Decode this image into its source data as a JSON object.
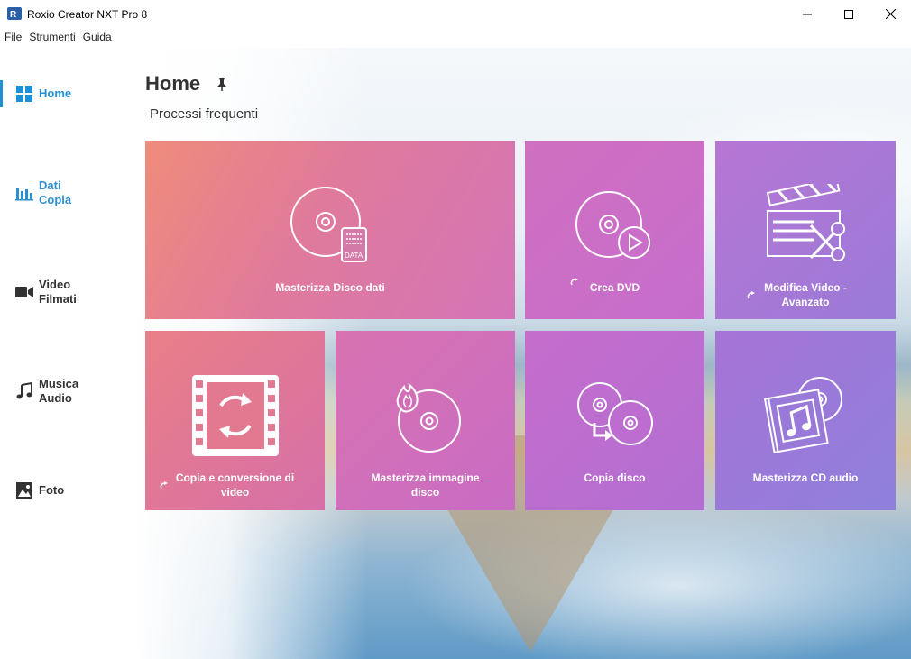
{
  "window": {
    "title": "Roxio Creator NXT Pro 8",
    "app_icon": "roxio-app-icon",
    "controls": [
      "minimize-icon",
      "maximize-icon",
      "close-icon"
    ]
  },
  "menu": [
    {
      "label": "File"
    },
    {
      "label": "Strumenti"
    },
    {
      "label": "Guida"
    }
  ],
  "sidebar": {
    "items": [
      {
        "label": "Home",
        "icon": "grid-icon",
        "active": true
      },
      {
        "label": "Dati\nCopia",
        "icon": "bar-chart-icon"
      },
      {
        "label": "Video\nFilmati",
        "icon": "video-camera-icon"
      },
      {
        "label": "Musica\nAudio",
        "icon": "music-note-icon"
      },
      {
        "label": "Foto",
        "icon": "photo-icon"
      }
    ]
  },
  "main": {
    "title": "Home",
    "pin_icon": "pin-icon",
    "section_title": "Processi frequenti",
    "tiles": [
      {
        "label": "Masterizza Disco dati",
        "icon": "data-disc-icon",
        "arrow": false,
        "color_start": "#ef8c7a",
        "color_end": "#d474b8"
      },
      {
        "label": "Crea  DVD",
        "icon": "dvd-play-icon",
        "arrow": true,
        "color_start": "#cf70c0",
        "color_end": "#c66dcd"
      },
      {
        "label": "Modifica Video -\nAvanzato",
        "icon": "video-edit-icon",
        "arrow": true,
        "color_start": "#b776d4",
        "color_end": "#9a7ad8"
      },
      {
        "label": "Copia e conversione di\nvideo",
        "icon": "film-convert-icon",
        "arrow": true,
        "color_start": "#e97f87",
        "color_end": "#d66fa8"
      },
      {
        "label": "Masterizza immagine\ndisco",
        "icon": "disc-burn-icon",
        "arrow": false,
        "color_start": "#d872b0",
        "color_end": "#c86cc4"
      },
      {
        "label": "Copia disco",
        "icon": "disc-copy-icon",
        "arrow": false,
        "color_start": "#c56dcc",
        "color_end": "#b26ed2"
      },
      {
        "label": "Masterizza CD audio",
        "icon": "audio-cd-icon",
        "arrow": false,
        "color_start": "#a673d6",
        "color_end": "#8f80dc"
      }
    ]
  }
}
